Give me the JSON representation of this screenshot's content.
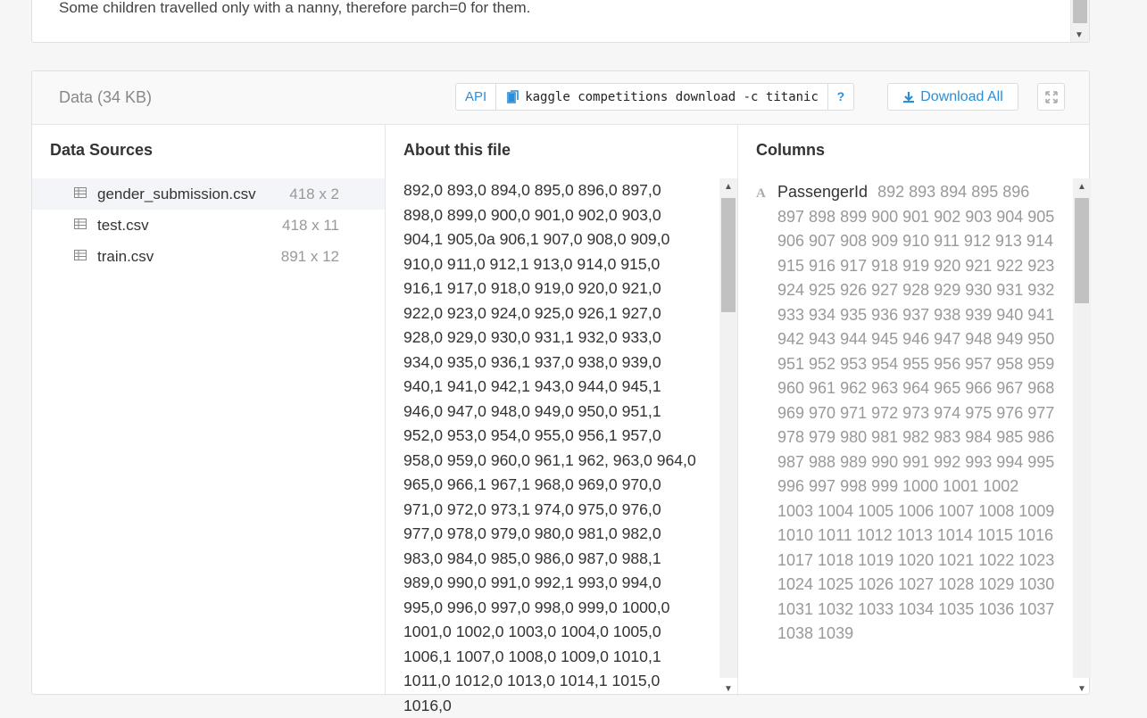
{
  "top_card": {
    "description": "Some children travelled only with a nanny, therefore parch=0 for them."
  },
  "data_section": {
    "title": "Data (34 KB)",
    "api_label": "API",
    "api_command": "kaggle competitions download -c titanic",
    "api_help": "?",
    "download_label": "Download All"
  },
  "sources": {
    "heading": "Data Sources",
    "files": [
      {
        "name": "gender_submission.csv",
        "size": "418 x 2"
      },
      {
        "name": "test.csv",
        "size": "418 x 11"
      },
      {
        "name": "train.csv",
        "size": "891 x 12"
      }
    ]
  },
  "about": {
    "heading": "About this file",
    "content": "892,0 893,0 894,0 895,0 896,0 897,0 898,0 899,0 900,0 901,0 902,0 903,0 904,1 905,0a 906,1 907,0 908,0 909,0 910,0 911,0 912,1 913,0 914,0 915,0 916,1 917,0 918,0 919,0 920,0 921,0 922,0 923,0 924,0 925,0 926,1 927,0 928,0 929,0 930,0 931,1 932,0 933,0 934,0 935,0 936,1 937,0 938,0 939,0 940,1 941,0 942,1 943,0 944,0 945,1 946,0 947,0 948,0 949,0 950,0 951,1 952,0 953,0 954,0 955,0 956,1 957,0 958,0 959,0 960,0 961,1 962, 963,0 964,0 965,0 966,1 967,1 968,0 969,0 970,0 971,0 972,0 973,1 974,0 975,0 976,0 977,0 978,0 979,0 980,0 981,0 982,0 983,0 984,0 985,0 986,0 987,0 988,1 989,0 990,0 991,0 992,1 993,0 994,0 995,0 996,0 997,0 998,0 999,0 1000,0 1001,0 1002,0 1003,0 1004,0 1005,0 1006,1 1007,0 1008,0 1009,0 1010,1 1011,0 1012,0 1013,0 1014,1 1015,0 1016,0"
  },
  "columns": {
    "heading": "Columns",
    "entries": [
      {
        "type_glyph": "A",
        "name": "PassengerId",
        "values": "892 893 894 895 896 897 898 899 900 901 902 903 904 905 906 907 908 909 910 911 912 913 914 915 916 917 918 919 920 921 922 923 924 925 926 927 928 929 930 931 932 933 934 935 936 937 938 939 940 941 942 943 944 945 946 947 948 949 950 951 952 953 954 955 956 957 958 959 960 961 962 963 964 965 966 967 968 969 970 971 972 973 974 975 976 977 978 979 980 981 982 983 984 985 986 987 988 989 990 991 992 993 994 995 996 997 998 999 1000 1001 1002 1003 1004 1005 1006 1007 1008 1009 1010 1011 1012 1013 1014 1015 1016 1017 1018 1019 1020 1021 1022 1023 1024 1025 1026 1027 1028 1029 1030 1031 1032 1033 1034 1035 1036 1037 1038 1039"
      }
    ]
  }
}
